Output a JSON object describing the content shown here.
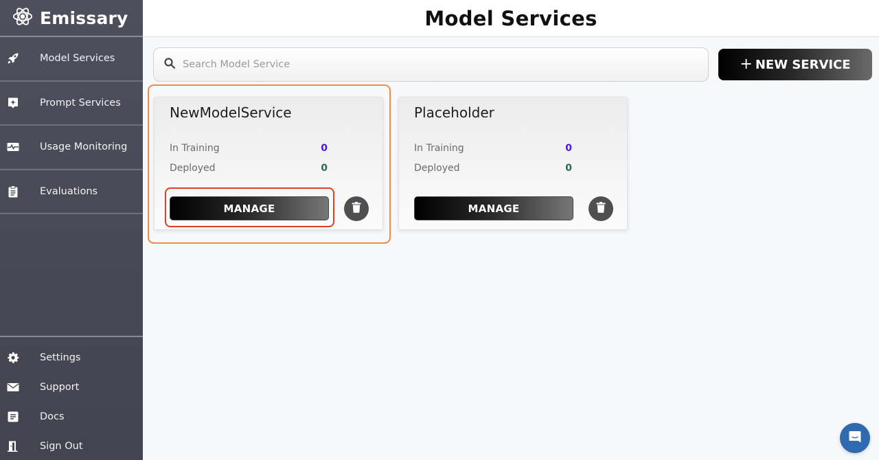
{
  "app": {
    "name": "Emissary",
    "logo_icon": "atom-icon"
  },
  "sidebar": {
    "items": [
      {
        "label": "Model Services",
        "icon": "rocket-icon"
      },
      {
        "label": "Prompt Services",
        "icon": "sparkle-badge-icon"
      },
      {
        "label": "Usage Monitoring",
        "icon": "pulse-icon"
      },
      {
        "label": "Evaluations",
        "icon": "clipboard-icon"
      }
    ],
    "bottom_items": [
      {
        "label": "Settings",
        "icon": "gear-icon"
      },
      {
        "label": "Support",
        "icon": "envelope-icon"
      },
      {
        "label": "Docs",
        "icon": "document-icon"
      },
      {
        "label": "Sign Out",
        "icon": "door-icon"
      }
    ]
  },
  "header": {
    "title": "Model Services"
  },
  "search": {
    "placeholder": "Search Model Service",
    "value": ""
  },
  "toolbar": {
    "new_service_plus": "+",
    "new_service_label": "NEW SERVICE"
  },
  "cards": [
    {
      "title": "NewModelService",
      "stats": [
        {
          "label": "In Training",
          "value": "0",
          "color": "#4a16d8"
        },
        {
          "label": "Deployed",
          "value": "0",
          "color": "#2f6a4a"
        }
      ],
      "manage_label": "MANAGE",
      "highlighted": true
    },
    {
      "title": "Placeholder",
      "stats": [
        {
          "label": "In Training",
          "value": "0",
          "color": "#4a16d8"
        },
        {
          "label": "Deployed",
          "value": "0",
          "color": "#2f6a4a"
        }
      ],
      "manage_label": "MANAGE",
      "highlighted": false
    }
  ],
  "colors": {
    "sidebar_bg": "#4a4b57",
    "highlight_card": "#ee8a4b",
    "highlight_button": "#e23d27",
    "chat_bubble": "#2f6ab0"
  }
}
